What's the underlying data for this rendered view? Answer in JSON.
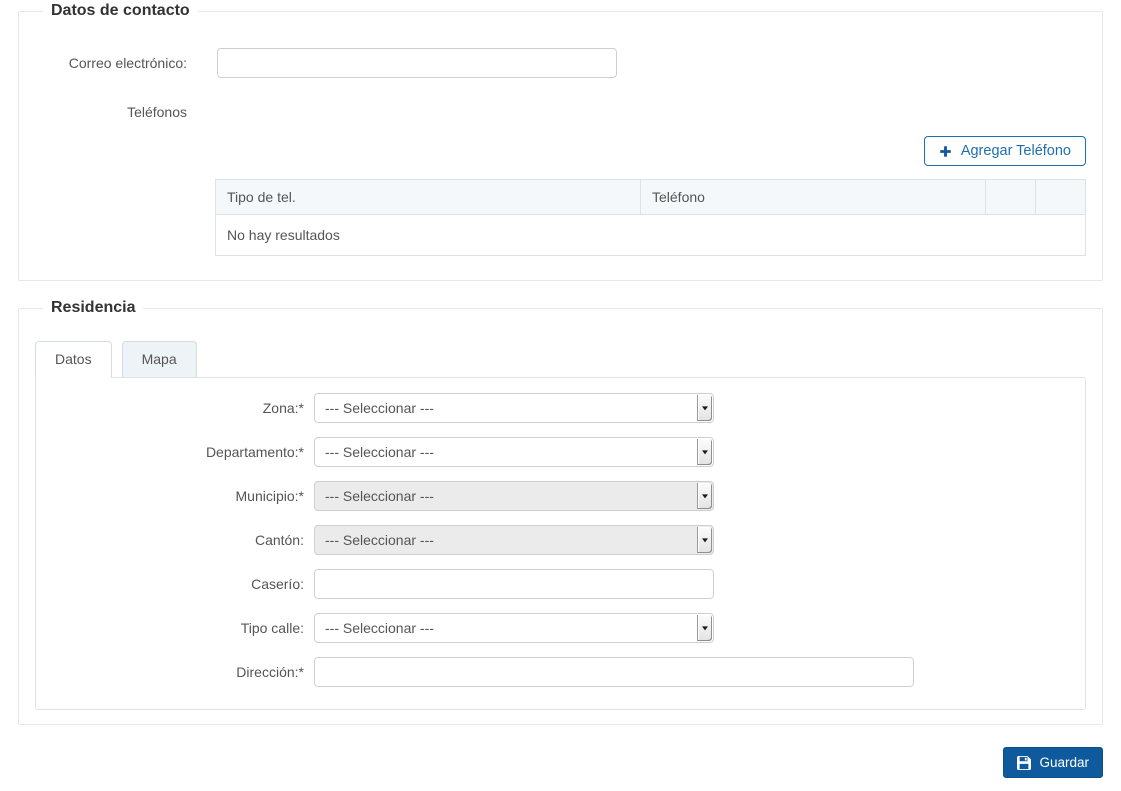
{
  "contact": {
    "legend": "Datos de contacto",
    "email": {
      "label": "Correo electrónico:",
      "value": ""
    },
    "phones": {
      "label": "Teléfonos",
      "add_button_label": "Agregar Teléfono",
      "table": {
        "headers": [
          "Tipo de tel.",
          "Teléfono",
          "",
          ""
        ],
        "empty_message": "No hay resultados"
      }
    }
  },
  "residence": {
    "legend": "Residencia",
    "tabs": [
      {
        "label": "Datos",
        "active": true
      },
      {
        "label": "Mapa",
        "active": false
      }
    ],
    "fields": [
      {
        "label": "Zona:*",
        "control": "select",
        "value": "--- Seleccionar ---",
        "disabled": false
      },
      {
        "label": "Departamento:*",
        "control": "select",
        "value": "--- Seleccionar ---",
        "disabled": false
      },
      {
        "label": "Municipio:*",
        "control": "select",
        "value": "--- Seleccionar ---",
        "disabled": true
      },
      {
        "label": "Cantón:",
        "control": "select",
        "value": "--- Seleccionar ---",
        "disabled": true
      },
      {
        "label": "Caserío:",
        "control": "text",
        "value": ""
      },
      {
        "label": "Tipo calle:",
        "control": "select",
        "value": "--- Seleccionar ---",
        "disabled": false
      },
      {
        "label": "Dirección:*",
        "control": "text",
        "value": "",
        "wide": true
      }
    ]
  },
  "footer": {
    "save_button_label": "Guardar"
  },
  "icons": {
    "add_phone": "plus-icon",
    "save": "save-icon",
    "select_dropdown": "chevron-down-icon"
  },
  "colors": {
    "accent_blue": "#15569b",
    "outline_button_blue": "#1e6fad",
    "save_button_bg": "#0f5a9d",
    "table_header_bg": "#f4f8fb",
    "disabled_bg": "#ebebeb",
    "fieldset_border": "#e4e7eb"
  }
}
